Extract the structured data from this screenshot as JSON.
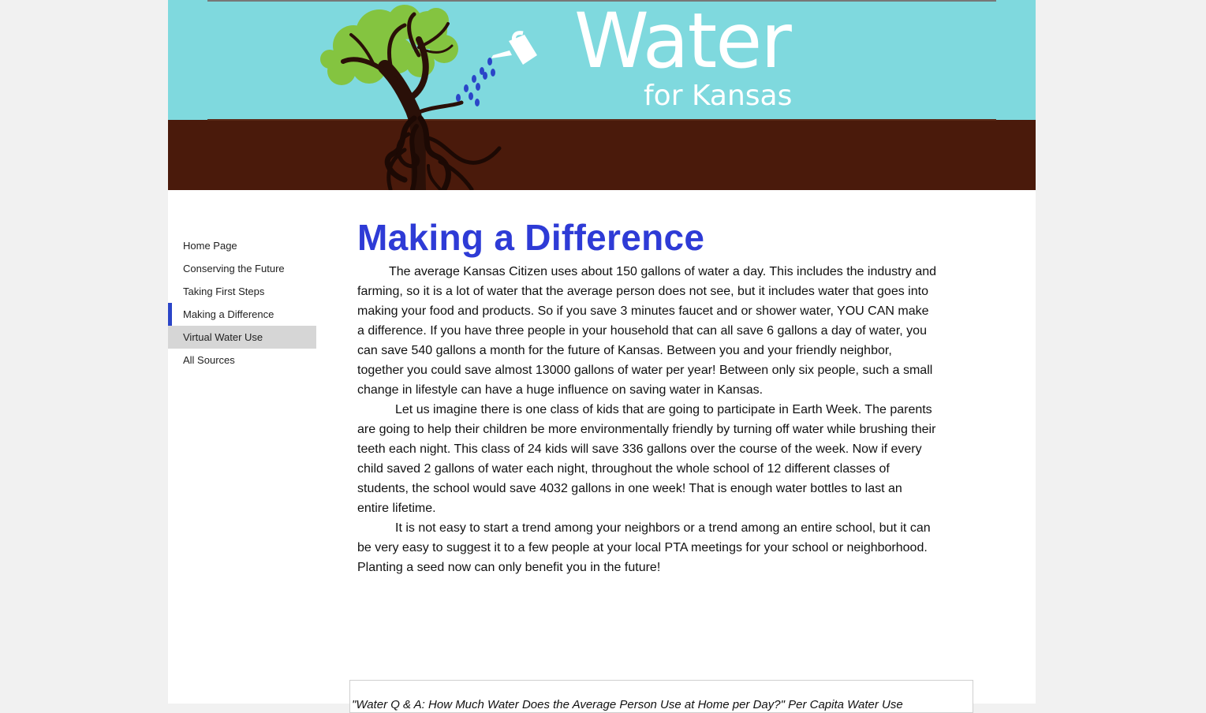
{
  "header": {
    "title": "Water",
    "subtitle": "for Kansas",
    "colors": {
      "sky": "#7fd9de",
      "soil": "#4a1a0b",
      "leaves": "#84c440",
      "trunk": "#2a1008",
      "drops": "#2b45c8"
    }
  },
  "nav": {
    "items": [
      {
        "label": "Home Page"
      },
      {
        "label": "Conserving the Future"
      },
      {
        "label": "Taking First Steps"
      },
      {
        "label": "Making a Difference",
        "state": "active"
      },
      {
        "label": "Virtual Water Use",
        "state": "hover"
      },
      {
        "label": "All Sources"
      }
    ]
  },
  "main": {
    "title": "Making a Difference",
    "paragraphs": [
      "The average Kansas Citizen uses about 150 gallons of water a day. This includes the industry and farming, so it is a lot of water that the average person does not see, but it includes water that goes into making your food and products. So if you save 3 minutes faucet and or shower water, YOU CAN make a difference. If you have three people in your household that can all save 6 gallons a day of water, you can save 540 gallons a month for the future of Kansas. Between you and your friendly neighbor, together you could save almost 13000 gallons of water per year! Between only six people, such a small change in lifestyle can have a huge influence on saving water in Kansas.",
      "Let us imagine there is one class of kids that are going to participate in Earth Week. The parents are going to help their children be more environmentally friendly by turning off water while brushing their teeth each night. This class of 24 kids will save 336 gallons over the course of the week. Now if every child saved 2 gallons of water each night, throughout the whole school of 12 different classes of students, the school would save 4032 gallons in one week! That is enough water bottles to last an entire lifetime.",
      "It is not easy to start a trend among your neighbors or a trend among an entire school, but it can be very easy to suggest it to a few people at your local PTA meetings for your school or neighborhood. Planting a seed now can only benefit you in the future!"
    ]
  },
  "footer": {
    "citation": "\"Water Q & A: How Much Water Does the Average Person Use at Home per Day?\" Per Capita Water Use"
  }
}
